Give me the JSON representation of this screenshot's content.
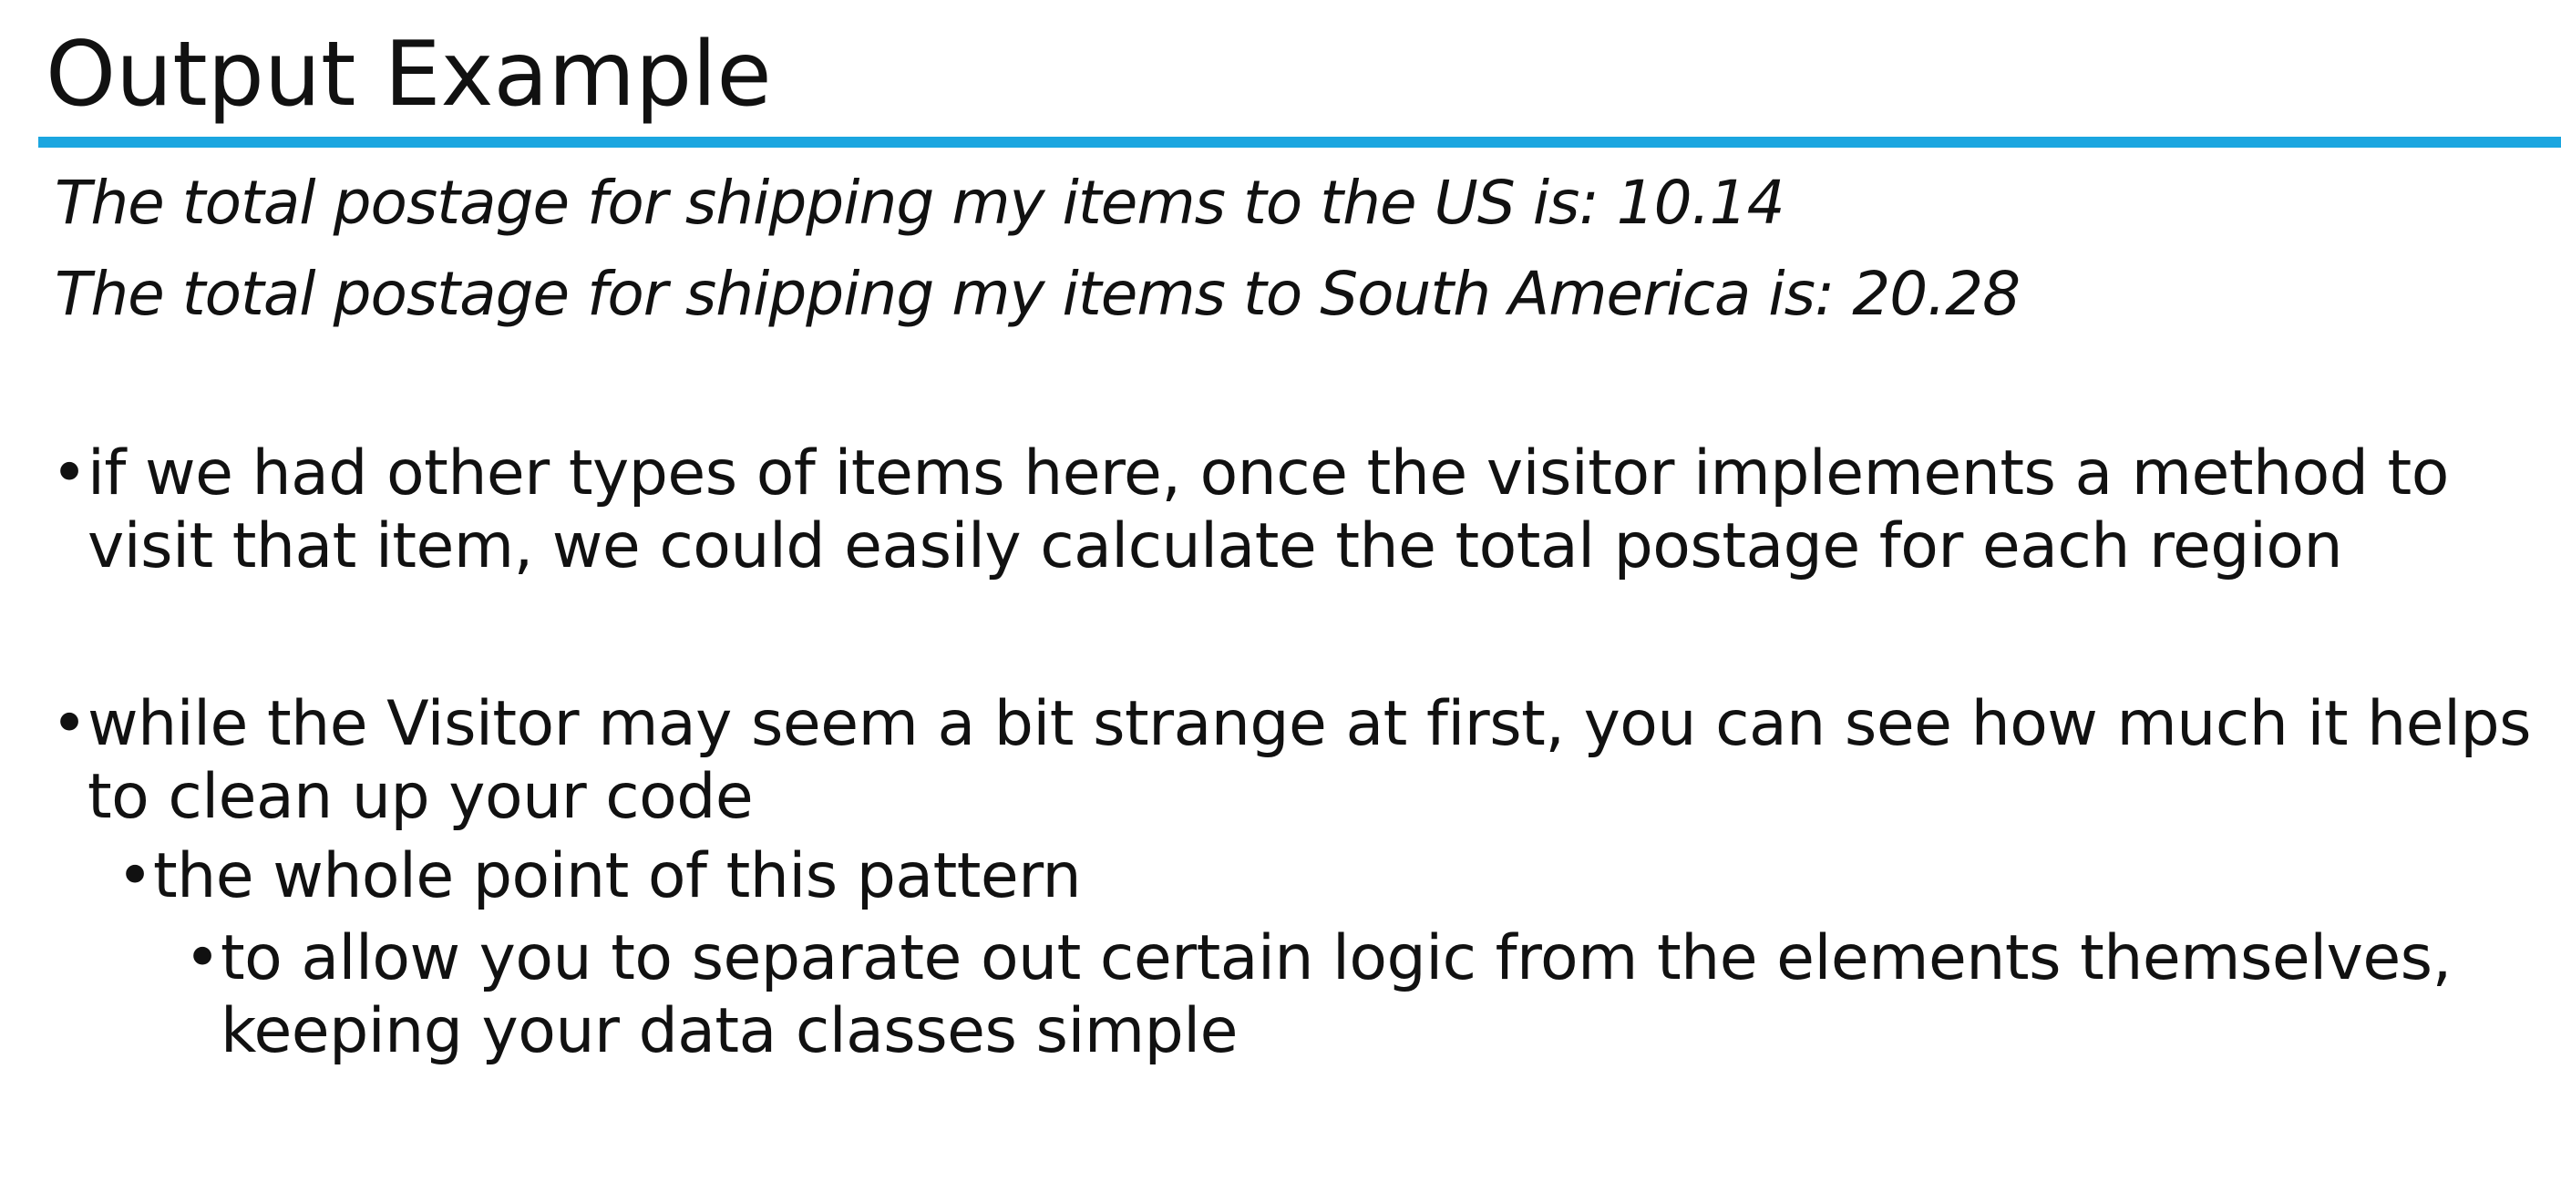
{
  "slide": {
    "title": "Output Example",
    "accent_color": "#1ba6e0",
    "output_lines": [
      "The total postage for shipping my items to the US is: 10.14",
      "The total postage for shipping my items to South America is: 20.28"
    ],
    "bullets": [
      {
        "level": 1,
        "line1": "if we had other types of items here, once the visitor implements a method to",
        "line2": "visit that item, we could easily calculate the total postage for each region"
      },
      {
        "level": 1,
        "line1": "while the Visitor may seem a bit strange at first, you can see how much it helps",
        "line2": "to clean up your code"
      },
      {
        "level": 2,
        "line1": "the whole point of this pattern"
      },
      {
        "level": 3,
        "line1": "to allow you to separate out certain logic from the elements themselves,",
        "line2": "keeping your data classes simple"
      }
    ],
    "bullet_glyph": "•"
  }
}
